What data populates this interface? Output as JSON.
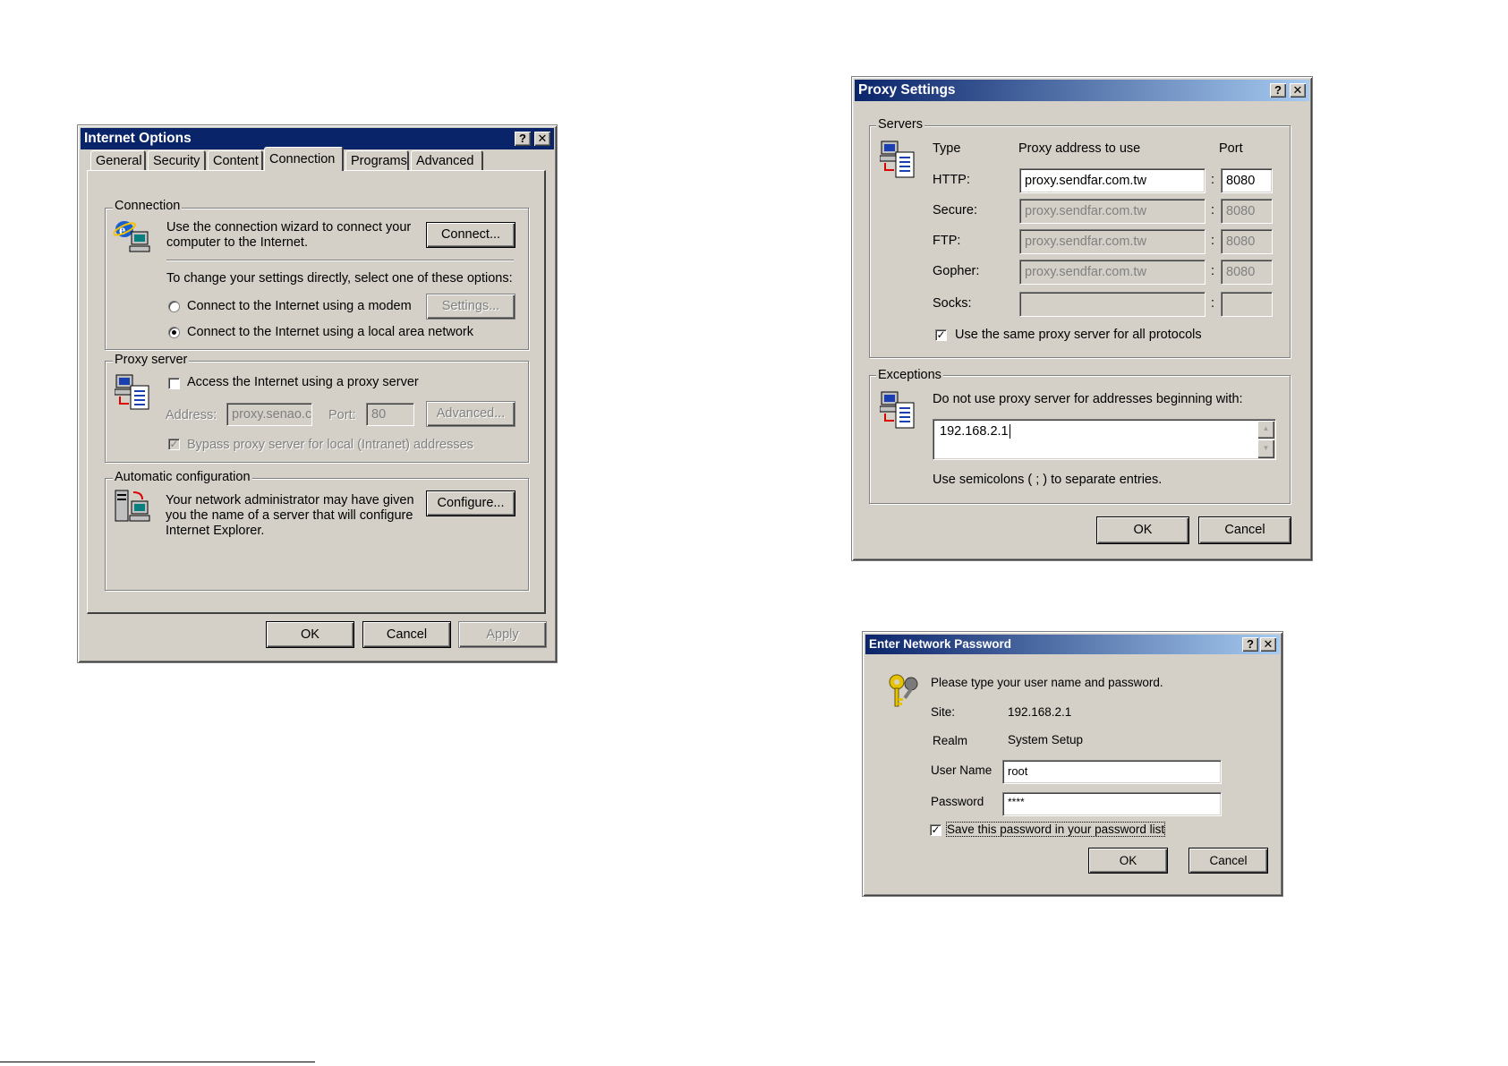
{
  "internet_options": {
    "title": "Internet Options",
    "tabs": [
      "General",
      "Security",
      "Content",
      "Connection",
      "Programs",
      "Advanced"
    ],
    "connection_group": {
      "label": "Connection",
      "wizard_text_line1": "Use the connection wizard to connect your",
      "wizard_text_line2": "computer to the Internet.",
      "connect_button": "Connect...",
      "change_text": "To change your settings directly, select one of these options:",
      "modem_option": "Connect to the Internet using a modem",
      "settings_button": "Settings...",
      "lan_option": "Connect to the Internet using a local area network"
    },
    "proxy_group": {
      "label": "Proxy server",
      "access_checkbox": "Access the Internet using a proxy server",
      "address_label": "Address:",
      "address_value": "proxy.senao.c",
      "port_label": "Port:",
      "port_value": "80",
      "advanced_button": "Advanced...",
      "bypass_checkbox": "Bypass proxy server for local (Intranet) addresses"
    },
    "auto_group": {
      "label": "Automatic configuration",
      "text_line1": "Your network administrator may have given",
      "text_line2": "you the name of a server that will configure",
      "text_line3": "Internet Explorer.",
      "configure_button": "Configure..."
    },
    "ok_button": "OK",
    "cancel_button": "Cancel",
    "apply_button": "Apply"
  },
  "proxy_settings": {
    "title": "Proxy Settings",
    "servers_label": "Servers",
    "col_type": "Type",
    "col_address": "Proxy address to use",
    "col_port": "Port",
    "rows": [
      {
        "type": "HTTP:",
        "address": "proxy.sendfar.com.tw",
        "port": "8080"
      },
      {
        "type": "Secure:",
        "address": "proxy.sendfar.com.tw",
        "port": "8080"
      },
      {
        "type": "FTP:",
        "address": "proxy.sendfar.com.tw",
        "port": "8080"
      },
      {
        "type": "Gopher:",
        "address": "proxy.sendfar.com.tw",
        "port": "8080"
      },
      {
        "type": "Socks:",
        "address": "",
        "port": ""
      }
    ],
    "colon": ":",
    "same_proxy_checkbox": "Use the same proxy server for all protocols",
    "exceptions_label": "Exceptions",
    "exceptions_text": "Do not use proxy server for addresses beginning with:",
    "exceptions_value": "192.168.2.1",
    "semicolon_text": "Use semicolons ( ; ) to separate entries.",
    "ok_button": "OK",
    "cancel_button": "Cancel"
  },
  "network_password": {
    "title": "Enter Network Password",
    "prompt": "Please type your user name and password.",
    "site_label": "Site:",
    "site_value": "192.168.2.1",
    "realm_label": "Realm",
    "realm_value": "System Setup",
    "username_label": "User Name",
    "username_value": "root",
    "password_label": "Password",
    "password_value": "****",
    "save_checkbox": "Save this password in your password list",
    "ok_button": "OK",
    "cancel_button": "Cancel"
  },
  "title_buttons": {
    "help": "?",
    "close": "✕"
  },
  "check_mark": "✓",
  "arrows": {
    "up": "▲",
    "down": "▼"
  }
}
